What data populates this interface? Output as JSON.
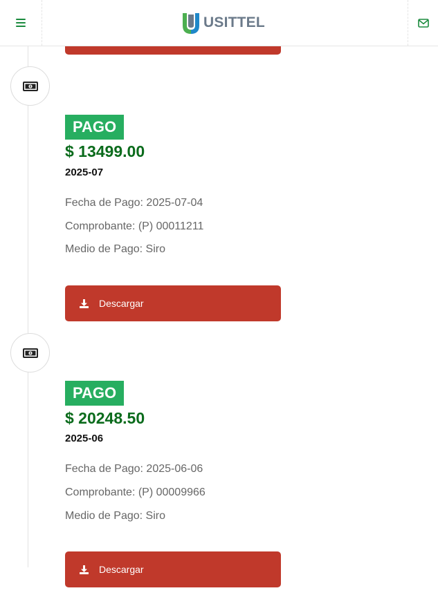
{
  "header": {
    "menu_icon": "bars-icon",
    "logo_text": "USITTEL",
    "logo_colors": {
      "green": "#4caf50",
      "blue": "#1f88c9",
      "text": "#6b7a8a"
    },
    "mail_icon": "envelope-icon"
  },
  "theme": {
    "accent_green": "#27ae60",
    "amount_green": "#0b6b1c",
    "button_red": "#c0392b"
  },
  "payments": [
    {
      "icon": "money-bill-icon",
      "badge": "PAGO",
      "amount": "$ 13499.00",
      "period": "2025-07",
      "fecha": "Fecha de Pago: 2025-07-04",
      "comprobante": "Comprobante: (P) 00011211",
      "medio": "Medio de Pago: Siro",
      "button_icon": "download-icon",
      "button_label": "Descargar"
    },
    {
      "icon": "money-bill-icon",
      "badge": "PAGO",
      "amount": "$ 20248.50",
      "period": "2025-06",
      "fecha": "Fecha de Pago: 2025-06-06",
      "comprobante": "Comprobante: (P) 00009966",
      "medio": "Medio de Pago: Siro",
      "button_icon": "download-icon",
      "button_label": "Descargar"
    }
  ]
}
